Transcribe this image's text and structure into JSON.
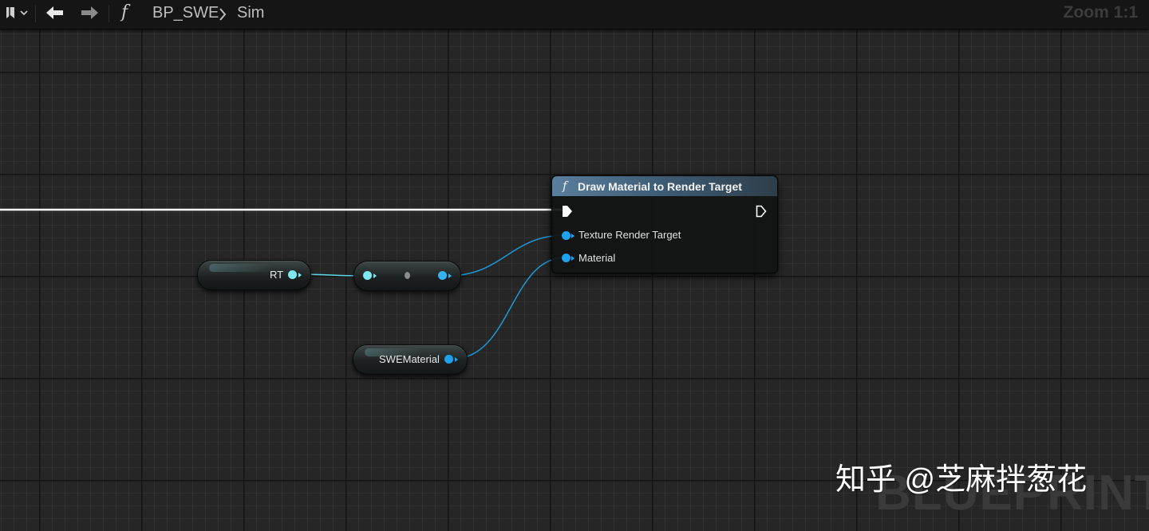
{
  "toolbar": {
    "bookmark_icon": "bookmark-icon",
    "back_icon": "arrow-left-icon",
    "forward_icon": "arrow-right-icon",
    "function_glyph": "f",
    "breadcrumb": [
      "BP_SWE",
      "Sim"
    ],
    "zoom": "Zoom 1:1"
  },
  "nodes": {
    "rt": {
      "label": "RT",
      "pin_color": "#7fe9f2"
    },
    "reroute": {
      "pin_color": "#36b4ee"
    },
    "swe_material": {
      "label": "SWEMaterial",
      "pin_color": "#1fa2ee"
    },
    "function": {
      "icon": "f",
      "title": "Draw Material to Render Target",
      "inputs": [
        "Texture Render Target",
        "Material"
      ],
      "pin_color": "#1fa2ee",
      "header_color": "#5a7e9d"
    }
  },
  "colors": {
    "exec_wire": "#ffffff",
    "data_wire": "#1b9ad6",
    "rt_wire": "#5cd8e6",
    "grid_bg": "#262626"
  },
  "watermark": {
    "blueprint": "BLUEPRINT",
    "zhihu": "知乎 @芝麻拌葱花"
  }
}
